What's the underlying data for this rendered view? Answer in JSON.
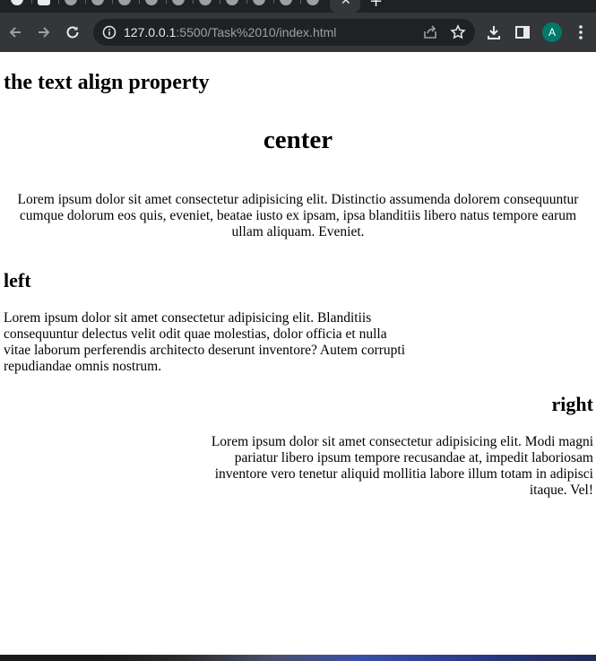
{
  "browser": {
    "url_host": "127.0.0.1",
    "url_rest": ":5500/Task%2010/index.html",
    "profile_initial": "A",
    "tab_count_icons": 12,
    "icons": {
      "back": "arrow-left-icon",
      "forward": "arrow-right-icon",
      "reload": "reload-icon",
      "site_info": "info-icon",
      "share": "share-icon",
      "bookmark": "star-icon",
      "download": "download-icon",
      "side_panel": "side-panel-icon",
      "menu": "kebab-menu-icon",
      "new_tab": "plus-icon",
      "close_tab": "close-icon"
    },
    "colors": {
      "toolbar": "#35363a",
      "tabstrip": "#202124",
      "avatar": "#00796b"
    }
  },
  "page": {
    "title": "the text align property",
    "center": {
      "heading": "center",
      "paragraph": "Lorem ipsum dolor sit amet consectetur adipisicing elit. Distinctio assumenda dolorem consequuntur cumque dolorum eos quis, eveniet, beatae iusto ex ipsam, ipsa blanditiis libero natus tempore earum ullam aliquam. Eveniet."
    },
    "left": {
      "heading": "left",
      "paragraph": "Lorem ipsum dolor sit amet consectetur adipisicing elit. Blanditiis consequuntur delectus velit odit quae molestias, dolor officia et nulla vitae laborum perferendis architecto deserunt inventore? Autem corrupti repudiandae omnis nostrum."
    },
    "right": {
      "heading": "right",
      "paragraph": "Lorem ipsum dolor sit amet consectetur adipisicing elit. Modi magni pariatur libero ipsum tempore recusandae at, impedit laboriosam inventore vero tenetur aliquid mollitia labore illum totam in adipisci itaque. Vel!"
    }
  }
}
